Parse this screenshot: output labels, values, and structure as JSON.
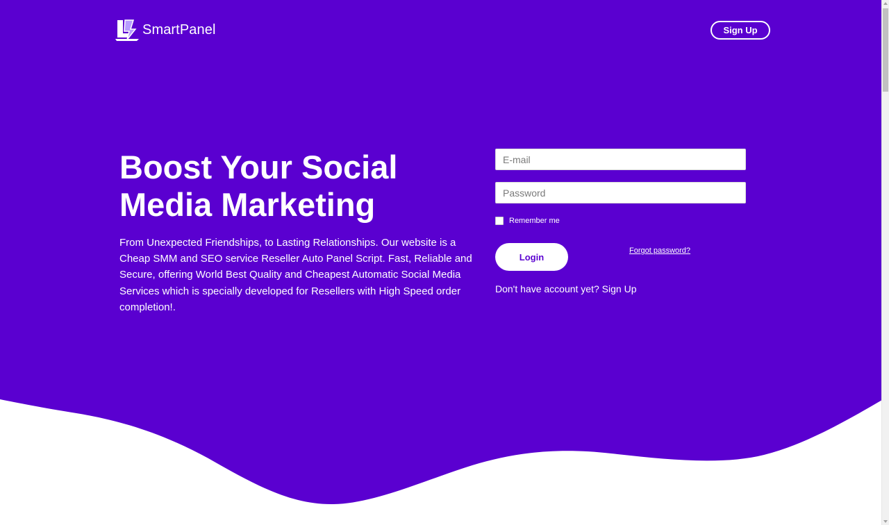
{
  "colors": {
    "primary": "#5a00d0",
    "background": "#ffffff",
    "text_on_primary": "#ffffff"
  },
  "header": {
    "logo_text": "SmartPanel",
    "signup_label": "Sign Up"
  },
  "hero": {
    "title": "Boost Your Social Media Marketing",
    "description": "From Unexpected Friendships, to Lasting Relationships. Our website is a Cheap SMM and SEO service Reseller Auto Panel Script. Fast, Reliable and Secure, offering World Best Quality and Cheapest Automatic Social Media Services which is specially developed for Resellers with High Speed order completion!."
  },
  "login_form": {
    "email_placeholder": "E-mail",
    "email_value": "",
    "password_placeholder": "Password",
    "password_value": "",
    "remember_label": "Remember me",
    "remember_checked": false,
    "login_label": "Login",
    "forgot_password_label": "Forgot password?",
    "no_account_text": "Don't have account yet?",
    "signup_link_label": "Sign Up"
  }
}
